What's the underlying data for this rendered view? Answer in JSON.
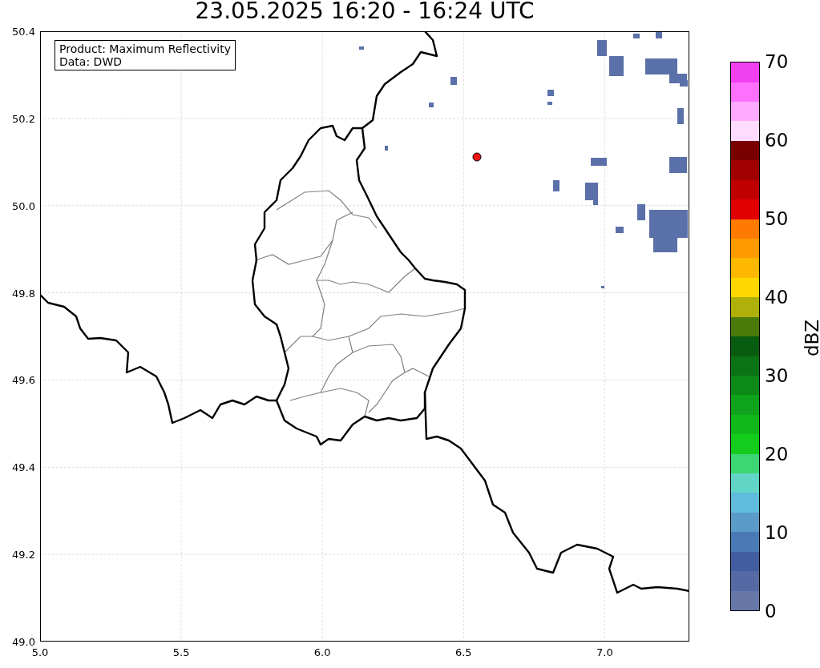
{
  "title": "23.05.2025 16:20 - 16:24 UTC",
  "info_box": [
    "Product: Maximum Reflectivity",
    "Data: DWD"
  ],
  "map": {
    "xticks": [
      "5.0",
      "5.5",
      "6.0",
      "6.5",
      "7.0"
    ],
    "yticks": [
      "50.4",
      "50.2",
      "50.0",
      "49.8",
      "49.6",
      "49.4",
      "49.2",
      "49.0"
    ]
  },
  "colorbar": {
    "label": "dBZ",
    "ticks": [
      "70",
      "60",
      "50",
      "40",
      "30",
      "20",
      "10",
      "0"
    ],
    "bands": [
      {
        "color": "#6677a8"
      },
      {
        "color": "#556aa5"
      },
      {
        "color": "#435ea0"
      },
      {
        "color": "#4a7ab5"
      },
      {
        "color": "#5a9bc8"
      },
      {
        "color": "#5fbcda"
      },
      {
        "color": "#62d6c6"
      },
      {
        "color": "#3cd672"
      },
      {
        "color": "#14cc1c"
      },
      {
        "color": "#10b81a"
      },
      {
        "color": "#0ea31a"
      },
      {
        "color": "#0c8a18"
      },
      {
        "color": "#0a7414"
      },
      {
        "color": "#085c10"
      },
      {
        "color": "#4a7a0a"
      },
      {
        "color": "#b0b00a"
      },
      {
        "color": "#ffd800"
      },
      {
        "color": "#ffb800"
      },
      {
        "color": "#ff9a00"
      },
      {
        "color": "#ff7a00"
      },
      {
        "color": "#e00000"
      },
      {
        "color": "#c00000"
      },
      {
        "color": "#a00000"
      },
      {
        "color": "#7a0000"
      },
      {
        "color": "#ffdcff"
      },
      {
        "color": "#ffaaff"
      },
      {
        "color": "#ff70ff"
      },
      {
        "color": "#f040f0"
      }
    ]
  }
}
